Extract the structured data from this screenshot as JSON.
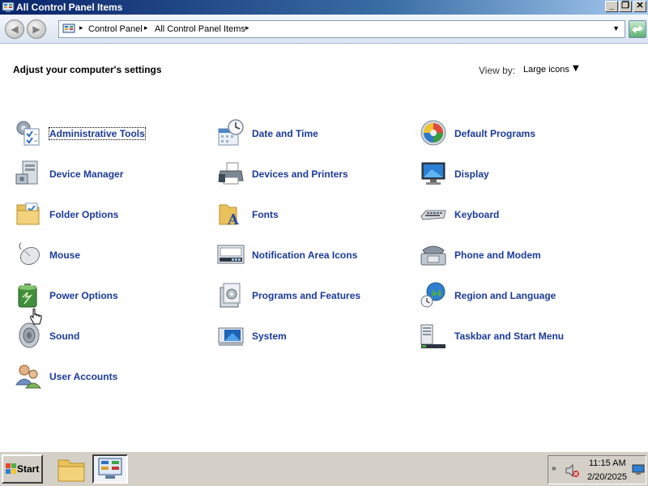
{
  "window": {
    "title": "All Control Panel Items",
    "minimize_label": "_",
    "restore_label": "❐",
    "close_label": "✕"
  },
  "nav": {
    "back_label": "◀",
    "forward_label": "▶",
    "breadcrumbs": [
      "Control Panel",
      "All Control Panel Items"
    ]
  },
  "header": {
    "heading": "Adjust your computer's settings",
    "view_by_label": "View by:",
    "view_by_value": "Large icons"
  },
  "items": [
    {
      "label": "Administrative Tools",
      "icon": "admin-tools-icon"
    },
    {
      "label": "Date and Time",
      "icon": "clock-calendar-icon"
    },
    {
      "label": "Default Programs",
      "icon": "default-programs-icon"
    },
    {
      "label": "Device Manager",
      "icon": "device-manager-icon"
    },
    {
      "label": "Devices and Printers",
      "icon": "printer-icon"
    },
    {
      "label": "Display",
      "icon": "monitor-icon"
    },
    {
      "label": "Folder Options",
      "icon": "folder-icon"
    },
    {
      "label": "Fonts",
      "icon": "fonts-folder-icon"
    },
    {
      "label": "Keyboard",
      "icon": "keyboard-icon"
    },
    {
      "label": "Mouse",
      "icon": "mouse-icon"
    },
    {
      "label": "Notification Area Icons",
      "icon": "notification-area-icon"
    },
    {
      "label": "Phone and Modem",
      "icon": "phone-icon"
    },
    {
      "label": "Power Options",
      "icon": "battery-icon"
    },
    {
      "label": "Programs and Features",
      "icon": "programs-icon"
    },
    {
      "label": "Region and Language",
      "icon": "globe-clock-icon"
    },
    {
      "label": "Sound",
      "icon": "speaker-icon"
    },
    {
      "label": "System",
      "icon": "system-icon"
    },
    {
      "label": "Taskbar and Start Menu",
      "icon": "taskbar-icon"
    },
    {
      "label": "User Accounts",
      "icon": "users-icon"
    }
  ],
  "taskbar": {
    "start_label": "Start",
    "time": "11:15 AM",
    "date": "2/20/2025",
    "tray_chevron": "»"
  }
}
